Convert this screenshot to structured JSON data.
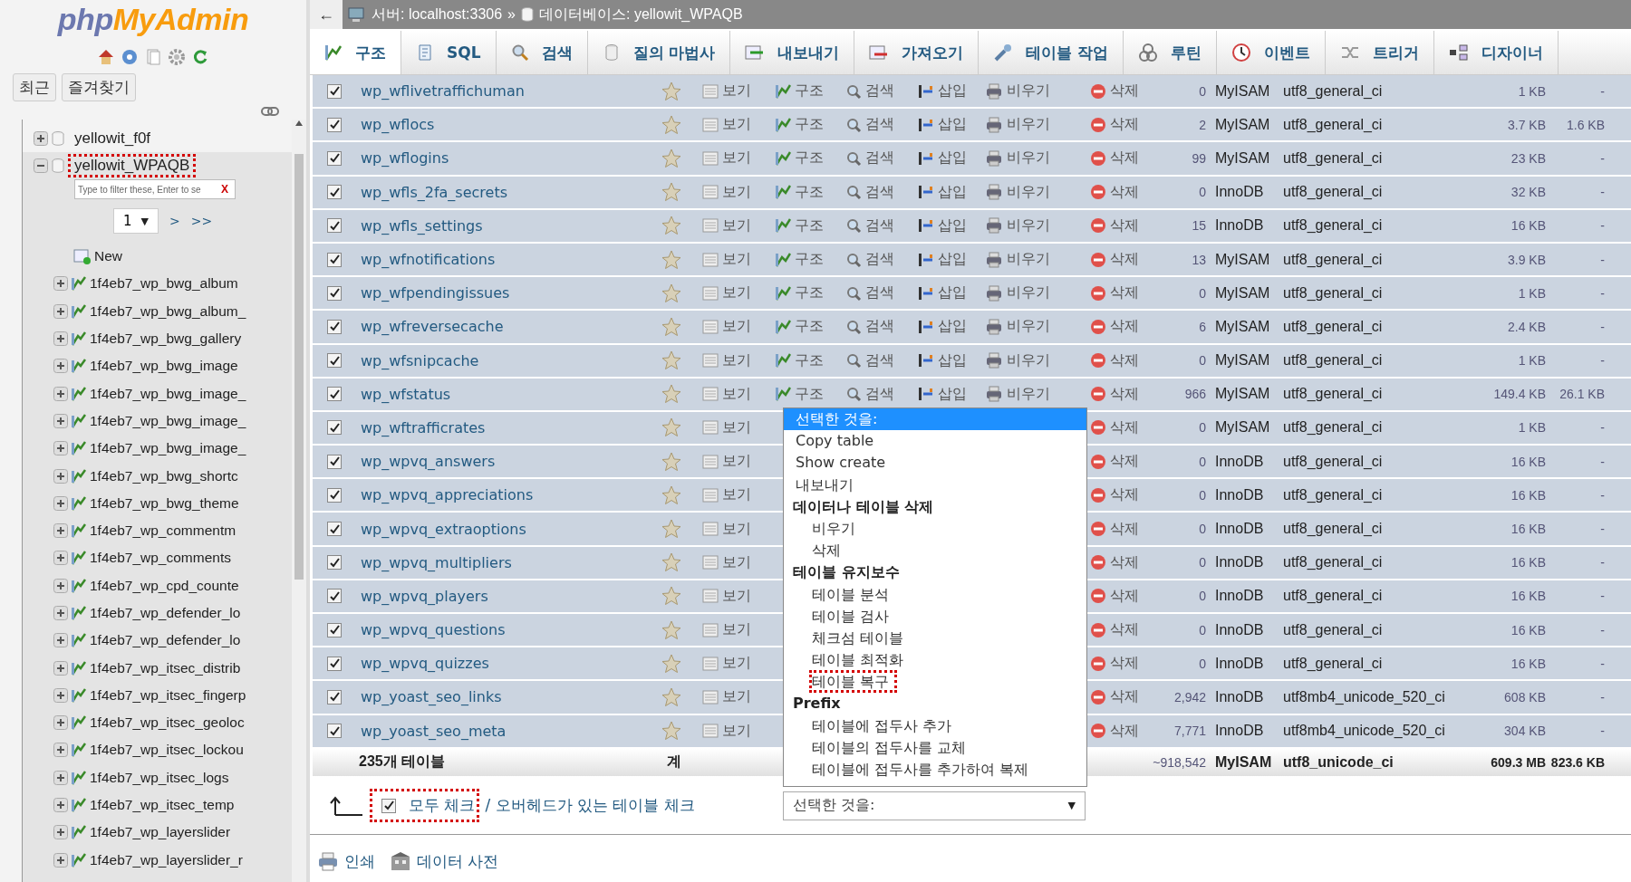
{
  "sidebar": {
    "logo": {
      "part1": "php",
      "part2": "MyAdmin"
    },
    "tabs": [
      {
        "label": "최근"
      },
      {
        "label": "즐겨찾기"
      }
    ],
    "tree": [
      {
        "label": "yellowit_f0f",
        "expanded": false,
        "highlighted": false
      },
      {
        "label": "yellowit_WPAQB",
        "expanded": true,
        "highlighted": true,
        "filter": {
          "placeholder": "Type to filter these, Enter to se",
          "clear": "X"
        },
        "pager": {
          "page": "1",
          "next": ">",
          "last": ">>"
        },
        "new_item": "New",
        "children": [
          {
            "label": "1f4eb7_wp_bwg_album"
          },
          {
            "label": "1f4eb7_wp_bwg_album_"
          },
          {
            "label": "1f4eb7_wp_bwg_gallery"
          },
          {
            "label": "1f4eb7_wp_bwg_image"
          },
          {
            "label": "1f4eb7_wp_bwg_image_"
          },
          {
            "label": "1f4eb7_wp_bwg_image_"
          },
          {
            "label": "1f4eb7_wp_bwg_image_"
          },
          {
            "label": "1f4eb7_wp_bwg_shortc"
          },
          {
            "label": "1f4eb7_wp_bwg_theme"
          },
          {
            "label": "1f4eb7_wp_commentm"
          },
          {
            "label": "1f4eb7_wp_comments"
          },
          {
            "label": "1f4eb7_wp_cpd_counte"
          },
          {
            "label": "1f4eb7_wp_defender_lo"
          },
          {
            "label": "1f4eb7_wp_defender_lo"
          },
          {
            "label": "1f4eb7_wp_itsec_distrib"
          },
          {
            "label": "1f4eb7_wp_itsec_fingerp"
          },
          {
            "label": "1f4eb7_wp_itsec_geoloc"
          },
          {
            "label": "1f4eb7_wp_itsec_lockou"
          },
          {
            "label": "1f4eb7_wp_itsec_logs"
          },
          {
            "label": "1f4eb7_wp_itsec_temp"
          },
          {
            "label": "1f4eb7_wp_layerslider"
          },
          {
            "label": "1f4eb7_wp_layerslider_r"
          }
        ]
      }
    ]
  },
  "breadcrumb": {
    "back": "←",
    "server": "서버: localhost:3306",
    "separator": "»",
    "database": "데이터베이스: yellowit_WPAQB"
  },
  "tabs": [
    {
      "label": "구조",
      "selected": true
    },
    {
      "label": "SQL",
      "selected": false
    },
    {
      "label": "검색",
      "selected": false
    },
    {
      "label": "질의 마법사",
      "selected": false
    },
    {
      "label": "내보내기",
      "selected": false
    },
    {
      "label": "가져오기",
      "selected": false
    },
    {
      "label": "테이블 작업",
      "selected": false
    },
    {
      "label": "루틴",
      "selected": false
    },
    {
      "label": "이벤트",
      "selected": false
    },
    {
      "label": "트리거",
      "selected": false
    },
    {
      "label": "디자이너",
      "selected": false
    }
  ],
  "table": {
    "rows": [
      {
        "checked": true,
        "name": "wp_wflivetraffichuman",
        "actions": [
          {
            "kind": "browse",
            "label": "보기"
          },
          {
            "kind": "structure",
            "label": "구조"
          },
          {
            "kind": "search",
            "label": "검색"
          },
          {
            "kind": "insert",
            "label": "삽입"
          },
          {
            "kind": "empty",
            "label": "비우기"
          },
          {
            "kind": "drop",
            "label": "삭제"
          }
        ],
        "rows": "0",
        "engine": "MyISAM",
        "collation": "utf8_general_ci",
        "size": "1 KB",
        "overhead": "-"
      },
      {
        "checked": true,
        "name": "wp_wflocs",
        "actions": [
          {
            "kind": "browse",
            "label": "보기"
          },
          {
            "kind": "structure",
            "label": "구조"
          },
          {
            "kind": "search",
            "label": "검색"
          },
          {
            "kind": "insert",
            "label": "삽입"
          },
          {
            "kind": "empty",
            "label": "비우기"
          },
          {
            "kind": "drop",
            "label": "삭제"
          }
        ],
        "rows": "2",
        "engine": "MyISAM",
        "collation": "utf8_general_ci",
        "size": "3.7 KB",
        "overhead": "1.6 KB"
      },
      {
        "checked": true,
        "name": "wp_wflogins",
        "actions": [
          {
            "kind": "browse",
            "label": "보기"
          },
          {
            "kind": "structure",
            "label": "구조"
          },
          {
            "kind": "search",
            "label": "검색"
          },
          {
            "kind": "insert",
            "label": "삽입"
          },
          {
            "kind": "empty",
            "label": "비우기"
          },
          {
            "kind": "drop",
            "label": "삭제"
          }
        ],
        "rows": "99",
        "engine": "MyISAM",
        "collation": "utf8_general_ci",
        "size": "23 KB",
        "overhead": "-"
      },
      {
        "checked": true,
        "name": "wp_wfls_2fa_secrets",
        "actions": [
          {
            "kind": "browse",
            "label": "보기"
          },
          {
            "kind": "structure",
            "label": "구조"
          },
          {
            "kind": "search",
            "label": "검색"
          },
          {
            "kind": "insert",
            "label": "삽입"
          },
          {
            "kind": "empty",
            "label": "비우기"
          },
          {
            "kind": "drop",
            "label": "삭제"
          }
        ],
        "rows": "0",
        "engine": "InnoDB",
        "collation": "utf8_general_ci",
        "size": "32 KB",
        "overhead": "-"
      },
      {
        "checked": true,
        "name": "wp_wfls_settings",
        "actions": [
          {
            "kind": "browse",
            "label": "보기"
          },
          {
            "kind": "structure",
            "label": "구조"
          },
          {
            "kind": "search",
            "label": "검색"
          },
          {
            "kind": "insert",
            "label": "삽입"
          },
          {
            "kind": "empty",
            "label": "비우기"
          },
          {
            "kind": "drop",
            "label": "삭제"
          }
        ],
        "rows": "15",
        "engine": "InnoDB",
        "collation": "utf8_general_ci",
        "size": "16 KB",
        "overhead": "-"
      },
      {
        "checked": true,
        "name": "wp_wfnotifications",
        "actions": [
          {
            "kind": "browse",
            "label": "보기"
          },
          {
            "kind": "structure",
            "label": "구조"
          },
          {
            "kind": "search",
            "label": "검색"
          },
          {
            "kind": "insert",
            "label": "삽입"
          },
          {
            "kind": "empty",
            "label": "비우기"
          },
          {
            "kind": "drop",
            "label": "삭제"
          }
        ],
        "rows": "13",
        "engine": "MyISAM",
        "collation": "utf8_general_ci",
        "size": "3.9 KB",
        "overhead": "-"
      },
      {
        "checked": true,
        "name": "wp_wfpendingissues",
        "actions": [
          {
            "kind": "browse",
            "label": "보기"
          },
          {
            "kind": "structure",
            "label": "구조"
          },
          {
            "kind": "search",
            "label": "검색"
          },
          {
            "kind": "insert",
            "label": "삽입"
          },
          {
            "kind": "empty",
            "label": "비우기"
          },
          {
            "kind": "drop",
            "label": "삭제"
          }
        ],
        "rows": "0",
        "engine": "MyISAM",
        "collation": "utf8_general_ci",
        "size": "1 KB",
        "overhead": "-"
      },
      {
        "checked": true,
        "name": "wp_wfreversecache",
        "actions": [
          {
            "kind": "browse",
            "label": "보기"
          },
          {
            "kind": "structure",
            "label": "구조"
          },
          {
            "kind": "search",
            "label": "검색"
          },
          {
            "kind": "insert",
            "label": "삽입"
          },
          {
            "kind": "empty",
            "label": "비우기"
          },
          {
            "kind": "drop",
            "label": "삭제"
          }
        ],
        "rows": "6",
        "engine": "MyISAM",
        "collation": "utf8_general_ci",
        "size": "2.4 KB",
        "overhead": "-"
      },
      {
        "checked": true,
        "name": "wp_wfsnipcache",
        "actions": [
          {
            "kind": "browse",
            "label": "보기"
          },
          {
            "kind": "structure",
            "label": "구조"
          },
          {
            "kind": "search",
            "label": "검색"
          },
          {
            "kind": "insert",
            "label": "삽입"
          },
          {
            "kind": "empty",
            "label": "비우기"
          },
          {
            "kind": "drop",
            "label": "삭제"
          }
        ],
        "rows": "0",
        "engine": "MyISAM",
        "collation": "utf8_general_ci",
        "size": "1 KB",
        "overhead": "-"
      },
      {
        "checked": true,
        "name": "wp_wfstatus",
        "actions": [
          {
            "kind": "browse",
            "label": "보기"
          },
          {
            "kind": "structure",
            "label": "구조"
          },
          {
            "kind": "search",
            "label": "검색"
          },
          {
            "kind": "insert",
            "label": "삽입"
          },
          {
            "kind": "empty",
            "label": "비우기"
          },
          {
            "kind": "drop",
            "label": "삭제"
          }
        ],
        "rows": "966",
        "engine": "MyISAM",
        "collation": "utf8_general_ci",
        "size": "149.4 KB",
        "overhead": "26.1 KB"
      },
      {
        "checked": true,
        "name": "wp_wftrafficrates",
        "actions": [
          {
            "kind": "browse",
            "label": "보기"
          },
          {
            "kind": "drop",
            "label": "삭제"
          }
        ],
        "rows": "0",
        "engine": "MyISAM",
        "collation": "utf8_general_ci",
        "size": "1 KB",
        "overhead": "-"
      },
      {
        "checked": true,
        "name": "wp_wpvq_answers",
        "actions": [
          {
            "kind": "browse",
            "label": "보기"
          },
          {
            "kind": "drop",
            "label": "삭제"
          }
        ],
        "rows": "0",
        "engine": "InnoDB",
        "collation": "utf8_general_ci",
        "size": "16 KB",
        "overhead": "-"
      },
      {
        "checked": true,
        "name": "wp_wpvq_appreciations",
        "actions": [
          {
            "kind": "browse",
            "label": "보기"
          },
          {
            "kind": "drop",
            "label": "삭제"
          }
        ],
        "rows": "0",
        "engine": "InnoDB",
        "collation": "utf8_general_ci",
        "size": "16 KB",
        "overhead": "-"
      },
      {
        "checked": true,
        "name": "wp_wpvq_extraoptions",
        "actions": [
          {
            "kind": "browse",
            "label": "보기"
          },
          {
            "kind": "drop",
            "label": "삭제"
          }
        ],
        "rows": "0",
        "engine": "InnoDB",
        "collation": "utf8_general_ci",
        "size": "16 KB",
        "overhead": "-"
      },
      {
        "checked": true,
        "name": "wp_wpvq_multipliers",
        "actions": [
          {
            "kind": "browse",
            "label": "보기"
          },
          {
            "kind": "drop",
            "label": "삭제"
          }
        ],
        "rows": "0",
        "engine": "InnoDB",
        "collation": "utf8_general_ci",
        "size": "16 KB",
        "overhead": "-"
      },
      {
        "checked": true,
        "name": "wp_wpvq_players",
        "actions": [
          {
            "kind": "browse",
            "label": "보기"
          },
          {
            "kind": "drop",
            "label": "삭제"
          }
        ],
        "rows": "0",
        "engine": "InnoDB",
        "collation": "utf8_general_ci",
        "size": "16 KB",
        "overhead": "-"
      },
      {
        "checked": true,
        "name": "wp_wpvq_questions",
        "actions": [
          {
            "kind": "browse",
            "label": "보기"
          },
          {
            "kind": "drop",
            "label": "삭제"
          }
        ],
        "rows": "0",
        "engine": "InnoDB",
        "collation": "utf8_general_ci",
        "size": "16 KB",
        "overhead": "-"
      },
      {
        "checked": true,
        "name": "wp_wpvq_quizzes",
        "actions": [
          {
            "kind": "browse",
            "label": "보기"
          },
          {
            "kind": "drop",
            "label": "삭제"
          }
        ],
        "rows": "0",
        "engine": "InnoDB",
        "collation": "utf8_general_ci",
        "size": "16 KB",
        "overhead": "-"
      },
      {
        "checked": true,
        "name": "wp_yoast_seo_links",
        "actions": [
          {
            "kind": "browse",
            "label": "보기"
          },
          {
            "kind": "drop",
            "label": "삭제"
          }
        ],
        "rows": "2,942",
        "engine": "InnoDB",
        "collation": "utf8mb4_unicode_520_ci",
        "size": "608 KB",
        "overhead": "-"
      },
      {
        "checked": true,
        "name": "wp_yoast_seo_meta",
        "actions": [
          {
            "kind": "browse",
            "label": "보기"
          },
          {
            "kind": "drop",
            "label": "삭제"
          }
        ],
        "rows": "7,771",
        "engine": "InnoDB",
        "collation": "utf8mb4_unicode_520_ci",
        "size": "304 KB",
        "overhead": "-"
      }
    ],
    "footer": {
      "count": "235개 테이블",
      "sum_label": "계",
      "rows": "~918,542",
      "engine": "MyISAM",
      "collation": "utf8_unicode_ci",
      "size": "609.3 MB",
      "overhead": "823.6 KB"
    }
  },
  "bulk": {
    "check_all": {
      "label": "모두 체크",
      "checked": true,
      "highlighted": true
    },
    "check_overhead": "/ 오버헤드가 있는 테이블 체크",
    "select": {
      "value": "선택한 것을:",
      "arrow": "▼"
    }
  },
  "menu": {
    "items": [
      {
        "kind": "option",
        "label": "선택한 것을:",
        "selected": true,
        "highlighted": false
      },
      {
        "kind": "option",
        "label": "Copy table",
        "selected": false,
        "highlighted": false
      },
      {
        "kind": "option",
        "label": "Show create",
        "selected": false,
        "highlighted": false
      },
      {
        "kind": "option",
        "label": "내보내기",
        "selected": false,
        "highlighted": false
      },
      {
        "kind": "group",
        "label": "데이터나 테이블 삭제",
        "children": [
          {
            "label": "비우기",
            "selected": false,
            "highlighted": false
          },
          {
            "label": "삭제",
            "selected": false,
            "highlighted": false
          }
        ]
      },
      {
        "kind": "group",
        "label": "테이블 유지보수",
        "children": [
          {
            "label": "테이블 분석",
            "selected": false,
            "highlighted": false
          },
          {
            "label": "테이블 검사",
            "selected": false,
            "highlighted": false
          },
          {
            "label": "체크섬 테이블",
            "selected": false,
            "highlighted": false
          },
          {
            "label": "테이블 최적화",
            "selected": false,
            "highlighted": false
          },
          {
            "label": "테이블 복구",
            "selected": false,
            "highlighted": true
          }
        ]
      },
      {
        "kind": "group",
        "label": "Prefix",
        "children": [
          {
            "label": "테이블에 접두사 추가",
            "selected": false,
            "highlighted": false
          },
          {
            "label": "테이블의 접두사를 교체",
            "selected": false,
            "highlighted": false
          },
          {
            "label": "테이블에 접두사를 추가하여 복제",
            "selected": false,
            "highlighted": false
          }
        ]
      }
    ]
  },
  "bottom_links": [
    {
      "label": "인쇄"
    },
    {
      "label": "데이터 사전"
    }
  ]
}
